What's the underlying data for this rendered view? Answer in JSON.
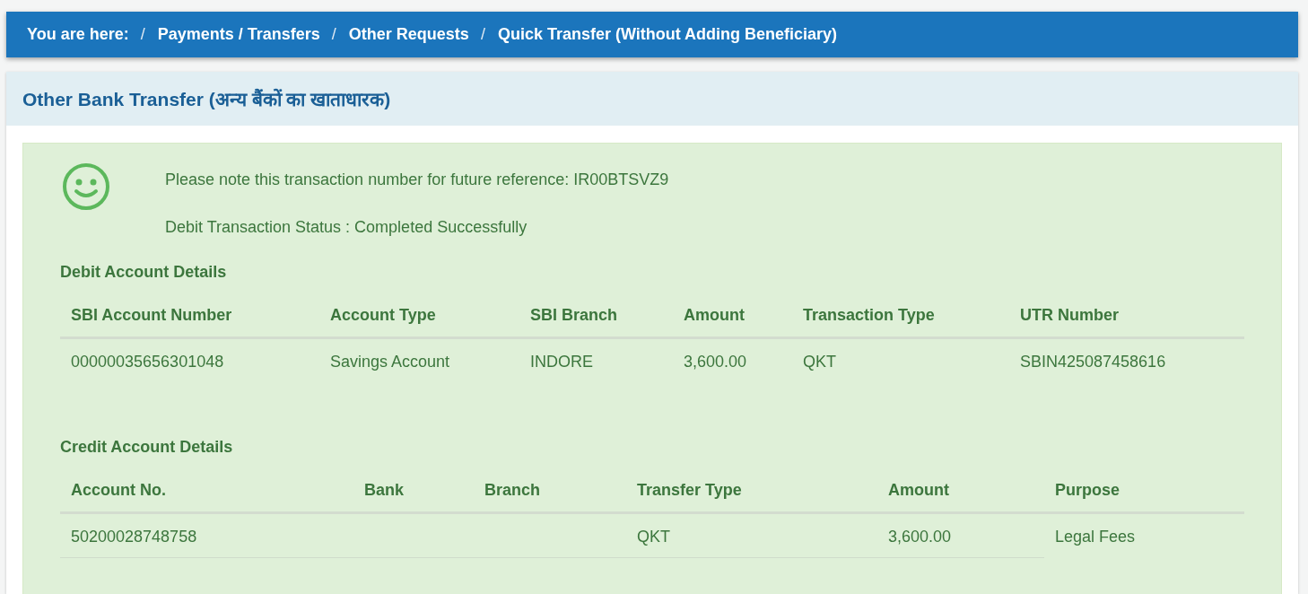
{
  "breadcrumb": {
    "label": "You are here:",
    "separator": "/",
    "items": [
      "Payments / Transfers",
      "Other Requests",
      "Quick Transfer (Without Adding Beneficiary)"
    ]
  },
  "panel": {
    "title": "Other Bank Transfer (अन्य बैंकों का खाताधारक)"
  },
  "message": {
    "reference": "Please note this transaction number for future reference: IR00BTSVZ9",
    "status": "Debit Transaction Status : Completed Successfully"
  },
  "sections": [
    {
      "heading": "Debit Account Details",
      "columns": [
        "SBI Account Number",
        "Account Type",
        "SBI Branch",
        "Amount",
        "Transaction Type",
        "UTR Number"
      ],
      "rows": [
        [
          "00000035656301048",
          "Savings Account",
          "INDORE",
          "3,600.00",
          "QKT",
          "SBIN425087458616"
        ]
      ]
    },
    {
      "heading": "Credit Account Details",
      "columns": [
        "Account No.",
        "Bank",
        "Branch",
        "Transfer Type",
        "Amount",
        "Purpose"
      ],
      "rows": [
        [
          "50200028748758",
          null,
          null,
          "QKT",
          "3,600.00",
          "Legal Fees"
        ]
      ]
    }
  ]
}
